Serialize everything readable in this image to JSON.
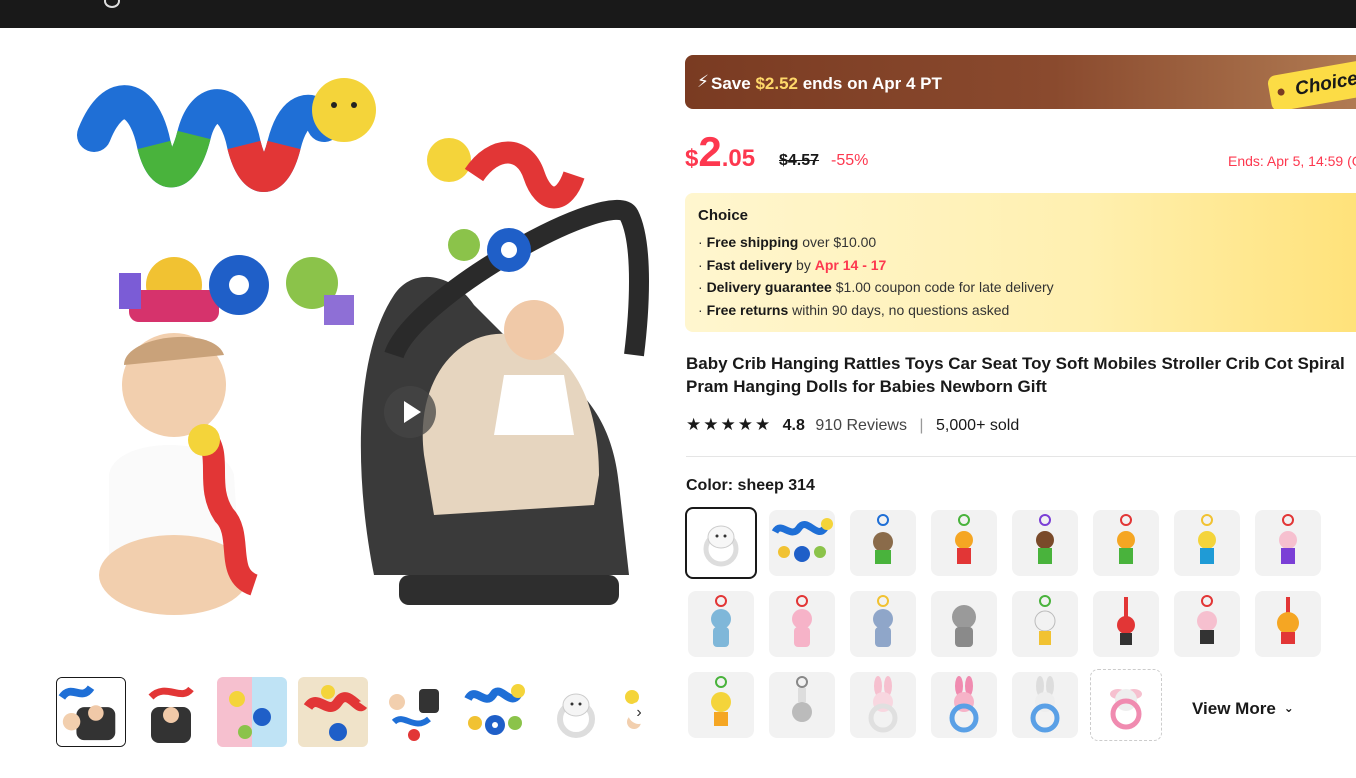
{
  "banner": {
    "bolt": "⚡",
    "prefix": "Save ",
    "amount": "$2.52",
    "suffix": " ends on Apr 4 PT",
    "tag": "Choice"
  },
  "price": {
    "currency": "$",
    "integer": "2",
    "decimal": ".05",
    "original": "$4.57",
    "discount": "-55%",
    "ends": "Ends: Apr 5, 14:59 (G"
  },
  "choice": {
    "title": "Choice",
    "lines": [
      {
        "bold": "Free shipping",
        "rest": " over $10.00"
      },
      {
        "bold": "Fast delivery",
        "mid": " by ",
        "red": "Apr 14 - 17"
      },
      {
        "bold": "Delivery guarantee",
        "rest": "  $1.00 coupon code for late delivery"
      },
      {
        "bold": "Free returns",
        "rest": "  within 90 days, no questions asked"
      }
    ],
    "bullet": "· "
  },
  "product": {
    "title": "Baby Crib Hanging Rattles Toys Car Seat Toy Soft Mobiles Stroller Crib Cot Spiral Pram Hanging Dolls for Babies Newborn Gift",
    "stars": "★★★★★",
    "rating": "4.8",
    "reviews": "910 Reviews",
    "separator": "|",
    "sold": "5,000+ sold"
  },
  "color": {
    "label": "Color: sheep 314"
  },
  "view_more": {
    "label": "View More",
    "chevron": "⌄"
  },
  "gallery": {
    "next": "›"
  },
  "colors": {
    "accent": "#fd384f",
    "choice_yellow": "#fcdc45",
    "dark": "#191919"
  }
}
